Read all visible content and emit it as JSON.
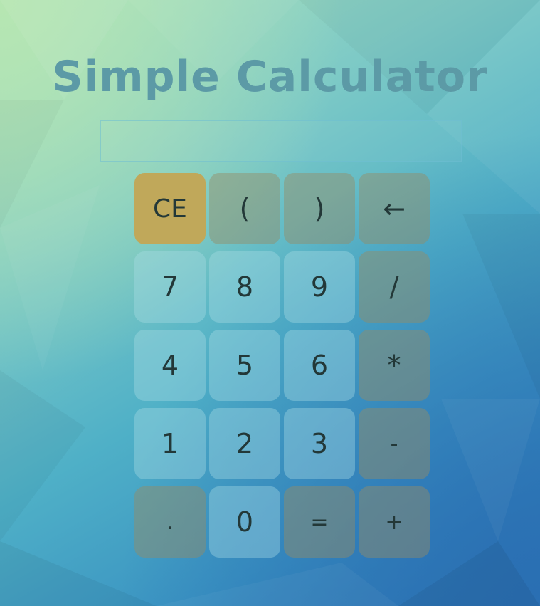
{
  "app": {
    "title": "Simple Calculator"
  },
  "display": {
    "value": ""
  },
  "keys": [
    {
      "label": "CE",
      "kind": "ce",
      "name": "clear-entry-button"
    },
    {
      "label": "(",
      "kind": "op",
      "name": "open-paren-button"
    },
    {
      "label": ")",
      "kind": "op",
      "name": "close-paren-button"
    },
    {
      "label": "←",
      "kind": "op",
      "name": "backspace-button"
    },
    {
      "label": "7",
      "kind": "num",
      "name": "digit-7-button"
    },
    {
      "label": "8",
      "kind": "num",
      "name": "digit-8-button"
    },
    {
      "label": "9",
      "kind": "num",
      "name": "digit-9-button"
    },
    {
      "label": "/",
      "kind": "op",
      "name": "divide-button"
    },
    {
      "label": "4",
      "kind": "num",
      "name": "digit-4-button"
    },
    {
      "label": "5",
      "kind": "num",
      "name": "digit-5-button"
    },
    {
      "label": "6",
      "kind": "num",
      "name": "digit-6-button"
    },
    {
      "label": "*",
      "kind": "op",
      "name": "multiply-button"
    },
    {
      "label": "1",
      "kind": "num",
      "name": "digit-1-button"
    },
    {
      "label": "2",
      "kind": "num",
      "name": "digit-2-button"
    },
    {
      "label": "3",
      "kind": "num",
      "name": "digit-3-button"
    },
    {
      "label": "-",
      "kind": "op",
      "name": "subtract-button"
    },
    {
      "label": ".",
      "kind": "op",
      "name": "decimal-point-button"
    },
    {
      "label": "0",
      "kind": "num",
      "name": "digit-0-button"
    },
    {
      "label": "=",
      "kind": "op",
      "name": "equals-button"
    },
    {
      "label": "+",
      "kind": "op",
      "name": "add-button"
    }
  ],
  "colors": {
    "title": "#5c9aa6",
    "ce_key": "#c0a85a",
    "operator_key": "#968c64",
    "number_key": "#aadce4"
  }
}
